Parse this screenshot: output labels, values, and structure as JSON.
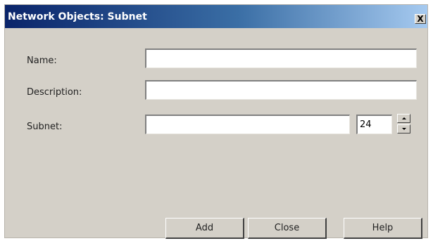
{
  "window": {
    "title": "Network Objects: Subnet",
    "close_glyph": "X"
  },
  "form": {
    "name_label": "Name:",
    "name_value": "",
    "description_label": "Description:",
    "description_value": "",
    "subnet_label": "Subnet:",
    "subnet_value": "",
    "prefix_value": "24"
  },
  "buttons": {
    "add_label": "Add",
    "close_label": "Close",
    "help_label": "Help"
  }
}
